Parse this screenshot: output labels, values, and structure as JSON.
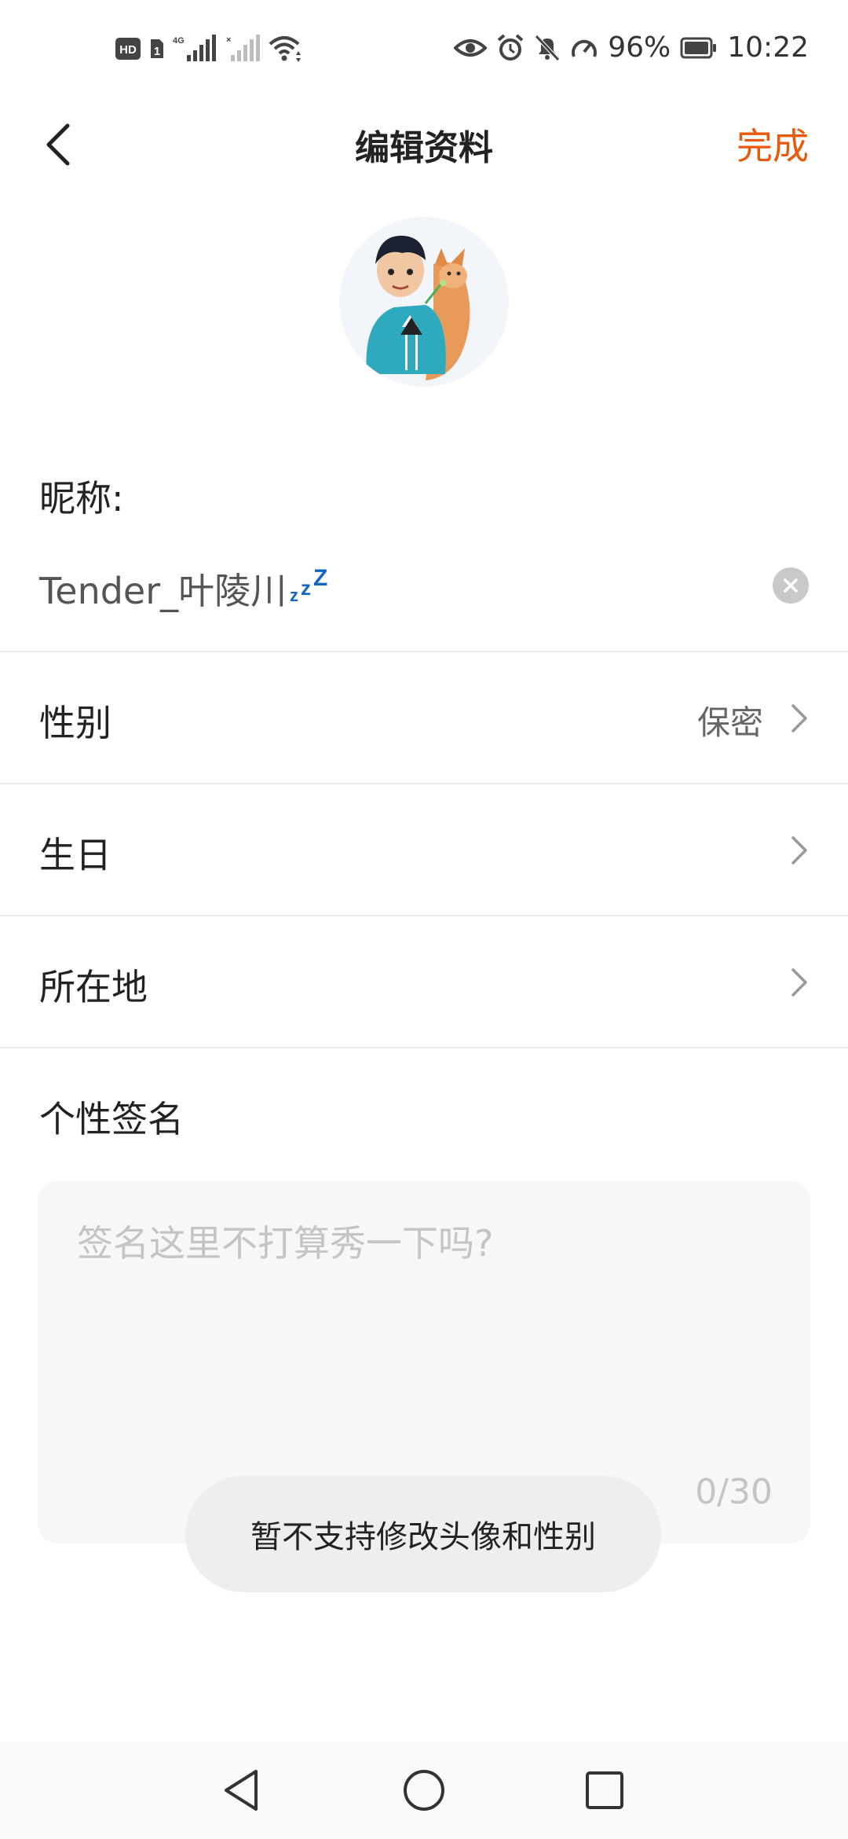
{
  "status_bar": {
    "hd_badge": "HD",
    "sim_badge": "1",
    "network_type": "4G",
    "battery_percent": "96%",
    "time": "10:22",
    "icons": [
      "hd-icon",
      "sim-icon",
      "signal-icon",
      "signal-empty-icon",
      "wifi-icon",
      "eye-icon",
      "alarm-icon",
      "mute-icon",
      "speed-icon",
      "battery-icon"
    ]
  },
  "header": {
    "title": "编辑资料",
    "done_label": "完成",
    "back_icon": "chevron-left-icon",
    "accent_color": "#e8590c"
  },
  "profile": {
    "avatar_icon": "user-avatar-illustration",
    "nickname_label": "昵称:",
    "nickname_value": "Tender_叶陵川",
    "nickname_emoji": "zzz",
    "clear_icon": "clear-icon"
  },
  "rows": [
    {
      "label": "性别",
      "value": "保密",
      "icon": "chevron-right-icon"
    },
    {
      "label": "生日",
      "value": "",
      "icon": "chevron-right-icon"
    },
    {
      "label": "所在地",
      "value": "",
      "icon": "chevron-right-icon"
    }
  ],
  "signature": {
    "label": "个性签名",
    "placeholder": "签名这里不打算秀一下吗?",
    "counter": "0/30"
  },
  "toast": {
    "message": "暂不支持修改头像和性别"
  },
  "nav_bar": {
    "icons": [
      "back-triangle-icon",
      "home-circle-icon",
      "recents-square-icon"
    ]
  }
}
